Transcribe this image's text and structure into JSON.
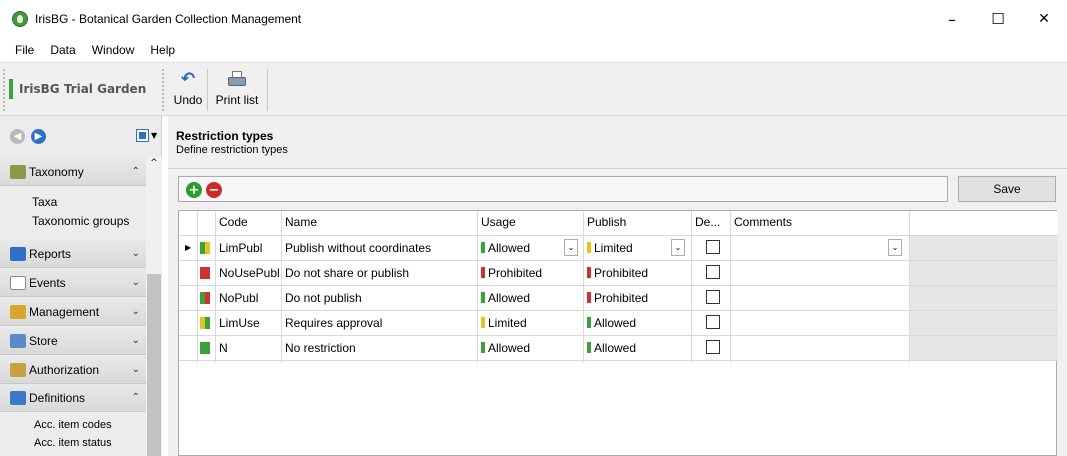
{
  "window": {
    "title": "IrisBG - Botanical Garden Collection Management",
    "minimize": "–",
    "maximize": "☐",
    "close": "✕"
  },
  "menu": [
    "File",
    "Data",
    "Window",
    "Help"
  ],
  "toolbar": {
    "garden": "IrisBG Trial Garden",
    "undo": "Undo",
    "print_list": "Print list"
  },
  "sidebar": {
    "groups": [
      {
        "label": "Taxonomy",
        "expanded": true,
        "icon": "taxonomy-icon",
        "color": "#7a8a3a",
        "items": [
          "Taxa",
          "Taxonomic groups"
        ]
      },
      {
        "label": "Reports",
        "expanded": false,
        "icon": "reports-icon",
        "color": "#2d71c9"
      },
      {
        "label": "Events",
        "expanded": false,
        "icon": "events-icon",
        "color": "#9a9a9a"
      },
      {
        "label": "Management",
        "expanded": false,
        "icon": "management-icon",
        "color": "#d9a52a"
      },
      {
        "label": "Store",
        "expanded": false,
        "icon": "store-icon",
        "color": "#5a8ac8"
      },
      {
        "label": "Authorization",
        "expanded": false,
        "icon": "authorization-icon",
        "color": "#c8a040"
      },
      {
        "label": "Definitions",
        "expanded": true,
        "icon": "definitions-icon",
        "color": "#3c78c8",
        "items": [
          "Acc. item codes",
          "Acc. item status"
        ]
      }
    ]
  },
  "section": {
    "title": "Restriction types",
    "subtitle": "Define restriction types"
  },
  "buttons": {
    "save": "Save"
  },
  "grid": {
    "columns": [
      "Code",
      "Name",
      "Usage",
      "Publish",
      "De...",
      "Comments"
    ],
    "rows": [
      {
        "code": "LimPubl",
        "name": "Publish without coordinates",
        "usage": "Allowed",
        "publish": "Limited",
        "current": true,
        "c1": "#3aa23a",
        "c2": "#e8c21e"
      },
      {
        "code": "NoUsePubl",
        "name": "Do not share or publish",
        "usage": "Prohibited",
        "publish": "Prohibited",
        "current": false,
        "c1": "#d03030",
        "c2": "#d03030"
      },
      {
        "code": "NoPubl",
        "name": "Do not publish",
        "usage": "Allowed",
        "publish": "Prohibited",
        "current": false,
        "c1": "#3aa23a",
        "c2": "#d03030"
      },
      {
        "code": "LimUse",
        "name": "Requires approval",
        "usage": "Limited",
        "publish": "Allowed",
        "current": false,
        "c1": "#e8c21e",
        "c2": "#3aa23a"
      },
      {
        "code": "N",
        "name": "No restriction",
        "usage": "Allowed",
        "publish": "Allowed",
        "current": false,
        "c1": "#3aa23a",
        "c2": "#3aa23a"
      }
    ]
  },
  "colors": {
    "Allowed": "#3aa23a",
    "Limited": "#e8c21e",
    "Prohibited": "#d03030"
  }
}
